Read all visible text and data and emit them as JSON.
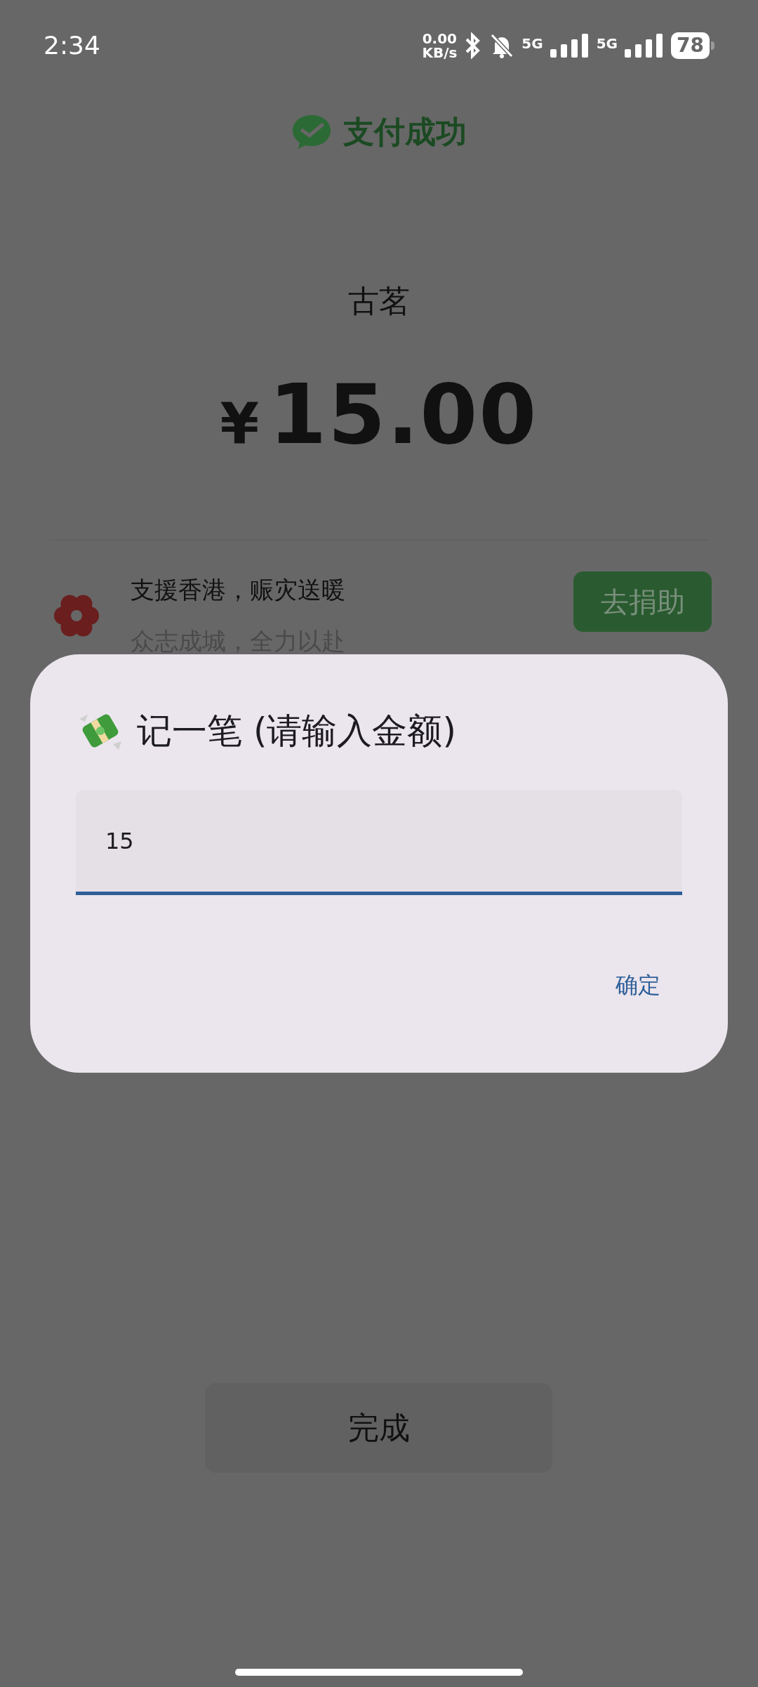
{
  "status_bar": {
    "time": "2:34",
    "net_speed_value": "0.00",
    "net_speed_unit": "KB/s",
    "signal_1": "5G",
    "signal_2": "5G",
    "battery": "78"
  },
  "header": {
    "title": "支付成功"
  },
  "payment": {
    "merchant": "古茗",
    "currency": "¥",
    "amount": "15.00"
  },
  "promo": {
    "title": "支援香港，赈灾送暖",
    "subtitle": "众志成城，全力以赴",
    "button": "去捐助"
  },
  "dialog": {
    "title": "记一笔 (请输入金额)",
    "value": "15",
    "confirm": "确定"
  },
  "done_button": "完成"
}
